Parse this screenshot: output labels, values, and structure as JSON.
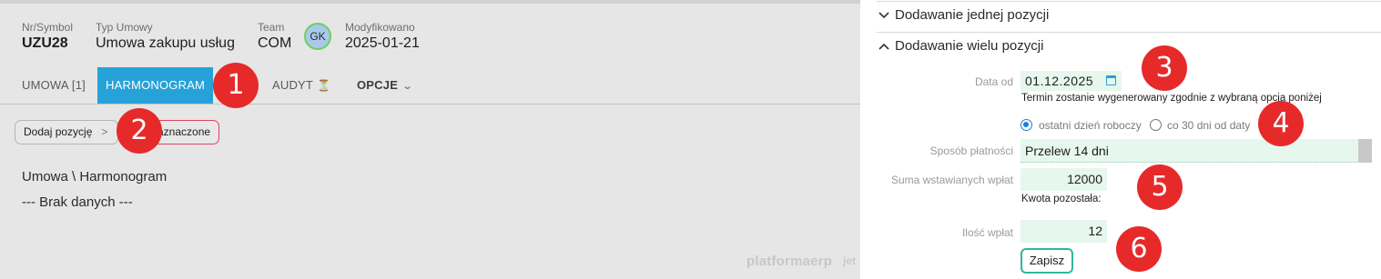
{
  "record": {
    "nr_label": "Nr/Symbol",
    "nr_value": "UZU28",
    "type_label": "Typ Umowy",
    "type_value": "Umowa zakupu usług",
    "team_label": "Team",
    "team_value": "COM",
    "avatar_initials": "GK",
    "modified_label": "Modyfikowano",
    "modified_value": "2025-01-21"
  },
  "tabs": {
    "umowa": "UMOWA [1]",
    "harmonogram": "HARMONOGRAM",
    "audyt": "AUDYT",
    "hourglass_icon": "⏳",
    "opcje": "OPCJE",
    "chevron": "⌄"
  },
  "toolbar": {
    "add_label": "Dodaj pozycję",
    "add_arrow": ">",
    "delete_label": "aznaczone"
  },
  "content": {
    "breadcrumb": "Umowa \\ Harmonogram",
    "empty": "--- Brak danych ---"
  },
  "branding": {
    "logo": "platformaerp",
    "logo_partial": "jet"
  },
  "right_panel": {
    "section_single": {
      "title": "Dodawanie jednej pozycji",
      "icon": "chevron-down"
    },
    "section_multi": {
      "title": "Dodawanie wielu pozycji",
      "icon": "chevron-up"
    },
    "date_label": "Data od",
    "date_value": "01.12.2025",
    "hint": "Termin zostanie wygenerowany zgodnie z wybraną opcją poniżej",
    "radio_options": [
      "ostatni dzień roboczy",
      "co 30 dni od daty"
    ],
    "radio_selected": "ostatni dzień roboczy",
    "payment_label": "Sposób płatności",
    "payment_value": "Przelew 14 dni",
    "sum_label": "Suma wstawianych wpłat",
    "sum_value": "12000",
    "remaining_label": "Kwota pozostała:",
    "count_label": "Ilość wpłat",
    "count_value": "12",
    "save_label": "Zapisz"
  },
  "markers": [
    "1",
    "2",
    "3",
    "4",
    "5",
    "6"
  ],
  "colors": {
    "accent_tab": "#26a2d8",
    "marker": "#e62a2a",
    "input_bg": "#e6f7ee",
    "save_border": "#2eb89a",
    "delete_border": "#e04463"
  }
}
